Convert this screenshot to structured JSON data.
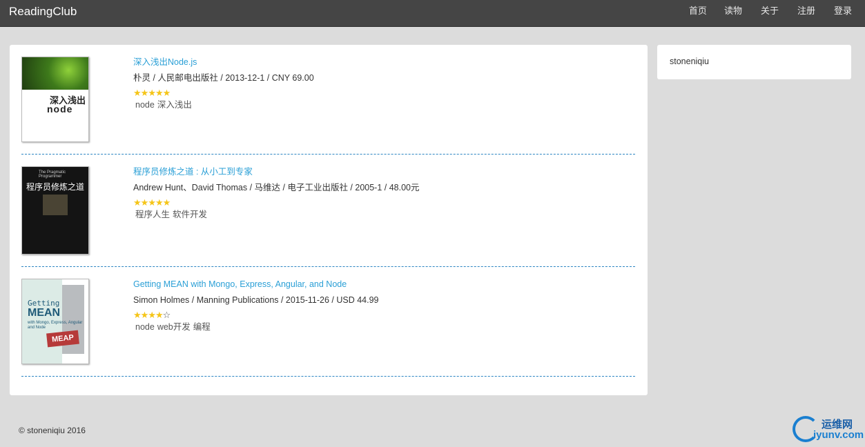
{
  "app": {
    "brand": "ReadingClub"
  },
  "nav": {
    "items": [
      "首页",
      "读物",
      "关于",
      "注册",
      "登录"
    ]
  },
  "books": [
    {
      "title": "深入浅出Node.js",
      "meta": "朴灵 / 人民邮电出版社 / 2013-12-1 / CNY 69.00",
      "rating": 5,
      "tags": [
        "node",
        "深入浅出"
      ],
      "cover": {
        "line1": "深入浅出",
        "line2": "node"
      }
    },
    {
      "title": "程序员修炼之道 : 从小工到专家",
      "meta": "Andrew Hunt、David Thomas / 马维达 / 电子工业出版社 / 2005-1 / 48.00元",
      "rating": 5,
      "tags": [
        "程序人生",
        "软件开发"
      ],
      "cover": {
        "line1": "The Pragmatic Programmer",
        "line2": "程序员修炼之道"
      }
    },
    {
      "title": "Getting MEAN with Mongo, Express, Angular, and Node",
      "meta": "Simon Holmes / Manning Publications / 2015-11-26 / USD 44.99",
      "rating": 4,
      "tags": [
        "node",
        "web开发",
        "编程"
      ],
      "cover": {
        "line1": "Getting",
        "line2": "MEAN",
        "line3": "with Mongo, Express, Angular and Node",
        "badge": "MEAP"
      }
    }
  ],
  "sidebar": {
    "username": "stoneniqiu"
  },
  "footer": {
    "copyright": "© stoneniqiu 2016"
  },
  "watermark": {
    "cn": "运维网",
    "en": "iyunv.com"
  },
  "colors": {
    "navbar": "#454545",
    "link": "#2a9fd6",
    "star": "#f5c518",
    "divider": "#2a84c2",
    "background": "#dcdcdc"
  }
}
